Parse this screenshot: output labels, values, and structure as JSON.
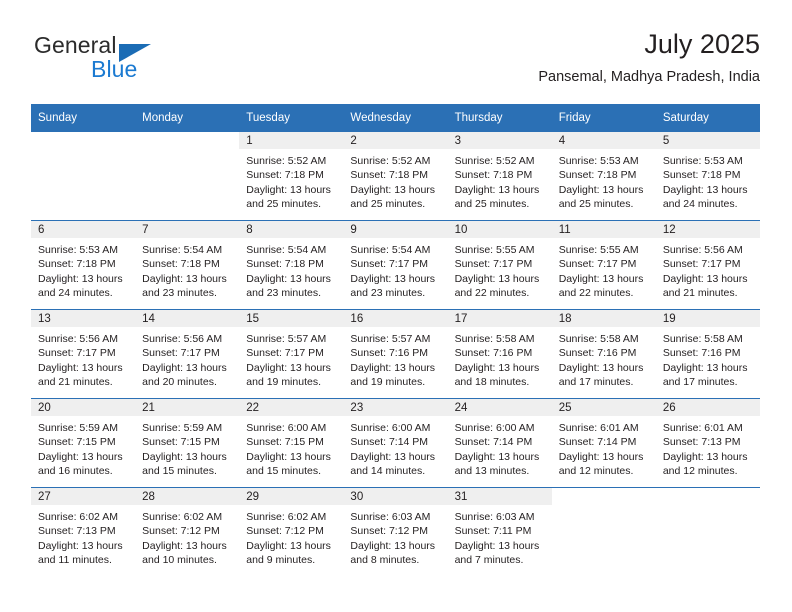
{
  "brand": {
    "name_part1": "General",
    "name_part2": "Blue",
    "triangle_color": "#1b6cb5",
    "blue_color": "#1b7ad1"
  },
  "header": {
    "title": "July 2025",
    "subtitle": "Pansemal, Madhya Pradesh, India"
  },
  "theme": {
    "header_blue": "#2b70b5",
    "daynum_band": "#efefef",
    "text": "#231f20"
  },
  "weekday_headers": [
    "Sunday",
    "Monday",
    "Tuesday",
    "Wednesday",
    "Thursday",
    "Friday",
    "Saturday"
  ],
  "labels": {
    "sunrise_prefix": "Sunrise: ",
    "sunset_prefix": "Sunset: ",
    "daylight_prefix": "Daylight: "
  },
  "weeks": [
    [
      {
        "day": "",
        "blank": true
      },
      {
        "day": "",
        "blank": true
      },
      {
        "day": "1",
        "sunrise": "Sunrise: 5:52 AM",
        "sunset": "Sunset: 7:18 PM",
        "daylight": "Daylight: 13 hours and 25 minutes."
      },
      {
        "day": "2",
        "sunrise": "Sunrise: 5:52 AM",
        "sunset": "Sunset: 7:18 PM",
        "daylight": "Daylight: 13 hours and 25 minutes."
      },
      {
        "day": "3",
        "sunrise": "Sunrise: 5:52 AM",
        "sunset": "Sunset: 7:18 PM",
        "daylight": "Daylight: 13 hours and 25 minutes."
      },
      {
        "day": "4",
        "sunrise": "Sunrise: 5:53 AM",
        "sunset": "Sunset: 7:18 PM",
        "daylight": "Daylight: 13 hours and 25 minutes."
      },
      {
        "day": "5",
        "sunrise": "Sunrise: 5:53 AM",
        "sunset": "Sunset: 7:18 PM",
        "daylight": "Daylight: 13 hours and 24 minutes."
      }
    ],
    [
      {
        "day": "6",
        "sunrise": "Sunrise: 5:53 AM",
        "sunset": "Sunset: 7:18 PM",
        "daylight": "Daylight: 13 hours and 24 minutes."
      },
      {
        "day": "7",
        "sunrise": "Sunrise: 5:54 AM",
        "sunset": "Sunset: 7:18 PM",
        "daylight": "Daylight: 13 hours and 23 minutes."
      },
      {
        "day": "8",
        "sunrise": "Sunrise: 5:54 AM",
        "sunset": "Sunset: 7:18 PM",
        "daylight": "Daylight: 13 hours and 23 minutes."
      },
      {
        "day": "9",
        "sunrise": "Sunrise: 5:54 AM",
        "sunset": "Sunset: 7:17 PM",
        "daylight": "Daylight: 13 hours and 23 minutes."
      },
      {
        "day": "10",
        "sunrise": "Sunrise: 5:55 AM",
        "sunset": "Sunset: 7:17 PM",
        "daylight": "Daylight: 13 hours and 22 minutes."
      },
      {
        "day": "11",
        "sunrise": "Sunrise: 5:55 AM",
        "sunset": "Sunset: 7:17 PM",
        "daylight": "Daylight: 13 hours and 22 minutes."
      },
      {
        "day": "12",
        "sunrise": "Sunrise: 5:56 AM",
        "sunset": "Sunset: 7:17 PM",
        "daylight": "Daylight: 13 hours and 21 minutes."
      }
    ],
    [
      {
        "day": "13",
        "sunrise": "Sunrise: 5:56 AM",
        "sunset": "Sunset: 7:17 PM",
        "daylight": "Daylight: 13 hours and 21 minutes."
      },
      {
        "day": "14",
        "sunrise": "Sunrise: 5:56 AM",
        "sunset": "Sunset: 7:17 PM",
        "daylight": "Daylight: 13 hours and 20 minutes."
      },
      {
        "day": "15",
        "sunrise": "Sunrise: 5:57 AM",
        "sunset": "Sunset: 7:17 PM",
        "daylight": "Daylight: 13 hours and 19 minutes."
      },
      {
        "day": "16",
        "sunrise": "Sunrise: 5:57 AM",
        "sunset": "Sunset: 7:16 PM",
        "daylight": "Daylight: 13 hours and 19 minutes."
      },
      {
        "day": "17",
        "sunrise": "Sunrise: 5:58 AM",
        "sunset": "Sunset: 7:16 PM",
        "daylight": "Daylight: 13 hours and 18 minutes."
      },
      {
        "day": "18",
        "sunrise": "Sunrise: 5:58 AM",
        "sunset": "Sunset: 7:16 PM",
        "daylight": "Daylight: 13 hours and 17 minutes."
      },
      {
        "day": "19",
        "sunrise": "Sunrise: 5:58 AM",
        "sunset": "Sunset: 7:16 PM",
        "daylight": "Daylight: 13 hours and 17 minutes."
      }
    ],
    [
      {
        "day": "20",
        "sunrise": "Sunrise: 5:59 AM",
        "sunset": "Sunset: 7:15 PM",
        "daylight": "Daylight: 13 hours and 16 minutes."
      },
      {
        "day": "21",
        "sunrise": "Sunrise: 5:59 AM",
        "sunset": "Sunset: 7:15 PM",
        "daylight": "Daylight: 13 hours and 15 minutes."
      },
      {
        "day": "22",
        "sunrise": "Sunrise: 6:00 AM",
        "sunset": "Sunset: 7:15 PM",
        "daylight": "Daylight: 13 hours and 15 minutes."
      },
      {
        "day": "23",
        "sunrise": "Sunrise: 6:00 AM",
        "sunset": "Sunset: 7:14 PM",
        "daylight": "Daylight: 13 hours and 14 minutes."
      },
      {
        "day": "24",
        "sunrise": "Sunrise: 6:00 AM",
        "sunset": "Sunset: 7:14 PM",
        "daylight": "Daylight: 13 hours and 13 minutes."
      },
      {
        "day": "25",
        "sunrise": "Sunrise: 6:01 AM",
        "sunset": "Sunset: 7:14 PM",
        "daylight": "Daylight: 13 hours and 12 minutes."
      },
      {
        "day": "26",
        "sunrise": "Sunrise: 6:01 AM",
        "sunset": "Sunset: 7:13 PM",
        "daylight": "Daylight: 13 hours and 12 minutes."
      }
    ],
    [
      {
        "day": "27",
        "sunrise": "Sunrise: 6:02 AM",
        "sunset": "Sunset: 7:13 PM",
        "daylight": "Daylight: 13 hours and 11 minutes."
      },
      {
        "day": "28",
        "sunrise": "Sunrise: 6:02 AM",
        "sunset": "Sunset: 7:12 PM",
        "daylight": "Daylight: 13 hours and 10 minutes."
      },
      {
        "day": "29",
        "sunrise": "Sunrise: 6:02 AM",
        "sunset": "Sunset: 7:12 PM",
        "daylight": "Daylight: 13 hours and 9 minutes."
      },
      {
        "day": "30",
        "sunrise": "Sunrise: 6:03 AM",
        "sunset": "Sunset: 7:12 PM",
        "daylight": "Daylight: 13 hours and 8 minutes."
      },
      {
        "day": "31",
        "sunrise": "Sunrise: 6:03 AM",
        "sunset": "Sunset: 7:11 PM",
        "daylight": "Daylight: 13 hours and 7 minutes."
      },
      {
        "day": "",
        "blank": true
      },
      {
        "day": "",
        "blank": true
      }
    ]
  ]
}
